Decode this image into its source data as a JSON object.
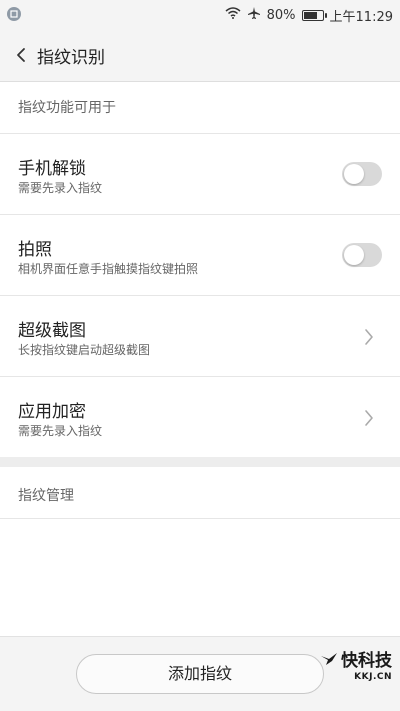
{
  "status_bar": {
    "battery_percent_text": "80%",
    "battery_level": 0.8,
    "time": "上午11:29",
    "icons": [
      "app-notification-icon",
      "wifi-icon",
      "airplane-icon",
      "battery-icon"
    ]
  },
  "header": {
    "title": "指纹识别",
    "back_icon": "chevron-left-icon"
  },
  "section_usage": {
    "label": "指纹功能可用于",
    "items": [
      {
        "title": "手机解锁",
        "subtitle": "需要先录入指纹",
        "control": "toggle",
        "enabled": false
      },
      {
        "title": "拍照",
        "subtitle": "相机界面任意手指触摸指纹键拍照",
        "control": "toggle",
        "enabled": false
      },
      {
        "title": "超级截图",
        "subtitle": "长按指纹键启动超级截图",
        "control": "chevron"
      },
      {
        "title": "应用加密",
        "subtitle": "需要先录入指纹",
        "control": "chevron"
      }
    ]
  },
  "section_manage": {
    "label": "指纹管理"
  },
  "footer": {
    "add_button_label": "添加指纹"
  },
  "watermark": {
    "main": "快科技",
    "sub": "KKJ.CN"
  },
  "colors": {
    "background": "#f7f7f7",
    "toggle_off": "#d9d9d9",
    "divider": "#e6e6e6"
  }
}
